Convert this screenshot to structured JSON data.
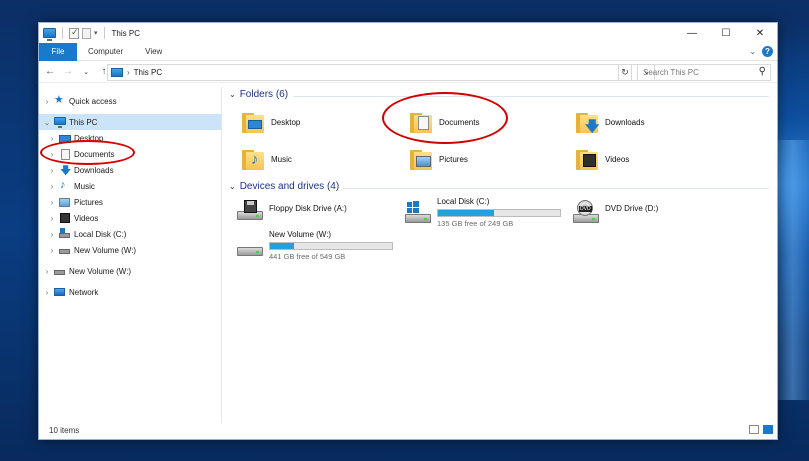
{
  "window": {
    "title": "This PC",
    "controls": {
      "minimize": "—",
      "maximize": "☐",
      "close": "✕"
    }
  },
  "ribbon": {
    "tabs": [
      "File",
      "Computer",
      "View"
    ]
  },
  "address": {
    "path": "This PC",
    "search_placeholder": "Search This PC"
  },
  "nav": {
    "items": [
      {
        "label": "Quick access",
        "icon": "star-icon"
      },
      {
        "label": "This PC",
        "icon": "computer-icon"
      },
      {
        "label": "Desktop",
        "icon": "desktop-folder-icon"
      },
      {
        "label": "Documents",
        "icon": "documents-icon"
      },
      {
        "label": "Downloads",
        "icon": "downloads-icon"
      },
      {
        "label": "Music",
        "icon": "music-icon"
      },
      {
        "label": "Pictures",
        "icon": "pictures-icon"
      },
      {
        "label": "Videos",
        "icon": "videos-icon"
      },
      {
        "label": "Local Disk (C:)",
        "icon": "drive-icon"
      },
      {
        "label": "New Volume (W:)",
        "icon": "drive-icon"
      },
      {
        "label": "New Volume (W:)",
        "icon": "drive-icon"
      },
      {
        "label": "Network",
        "icon": "network-icon"
      }
    ]
  },
  "folders": {
    "heading": "Folders (6)",
    "items": [
      {
        "label": "Desktop"
      },
      {
        "label": "Documents"
      },
      {
        "label": "Downloads"
      },
      {
        "label": "Music"
      },
      {
        "label": "Pictures"
      },
      {
        "label": "Videos"
      }
    ]
  },
  "drives": {
    "heading": "Devices and drives (4)",
    "items": [
      {
        "label": "Floppy Disk Drive (A:)"
      },
      {
        "label": "Local Disk (C:)",
        "free": "135 GB free of 249 GB",
        "used_fraction": 0.46
      },
      {
        "label": "DVD Drive (D:)"
      },
      {
        "label": "New Volume (W:)",
        "free": "441 GB free of 549 GB",
        "used_fraction": 0.2
      }
    ]
  },
  "status": {
    "count": "10 items"
  },
  "colors": {
    "accent": "#1979ca",
    "selection": "#cce4f7",
    "heading": "#1e3287",
    "bar": "#26a0da",
    "annotation": "#d40000"
  }
}
